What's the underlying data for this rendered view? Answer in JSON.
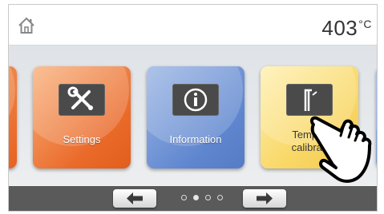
{
  "header": {
    "temperature_value": "403",
    "temperature_unit": "°C",
    "home_icon": "home-icon"
  },
  "tiles": [
    {
      "label": "Settings",
      "icon": "tools-icon",
      "color": "#ea6a2a"
    },
    {
      "label": "Information",
      "icon": "info-icon",
      "color": "#5f86cf"
    },
    {
      "label_line1": "Temper",
      "label_line2": "calibrati",
      "icon": "temperature-probe-icon",
      "color": "#f9d868"
    }
  ],
  "footer": {
    "prev_icon": "arrow-left-icon",
    "next_icon": "arrow-right-icon",
    "page_count": 4,
    "active_page": 2
  },
  "overlay": {
    "icon": "hand-pointer-icon"
  }
}
